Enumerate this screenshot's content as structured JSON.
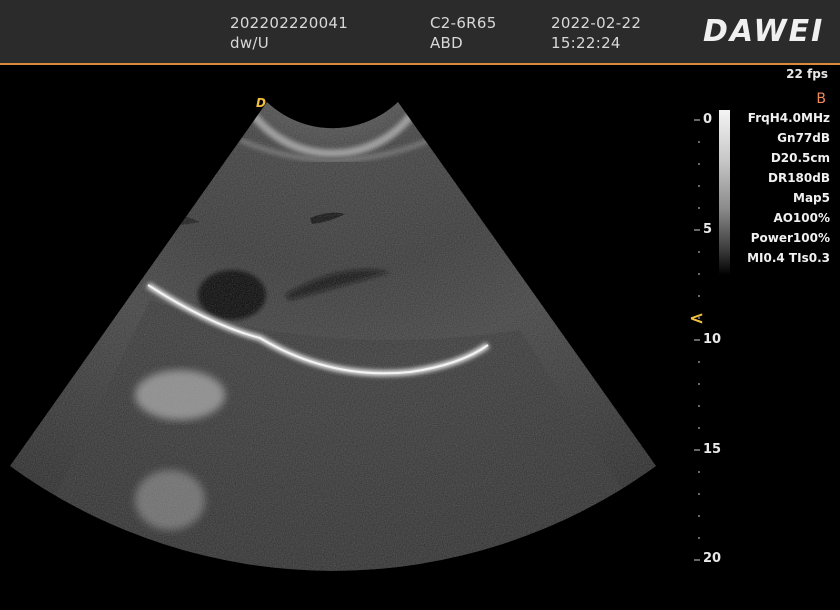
{
  "header": {
    "patient_id": "202202220041",
    "operator": "dw/U",
    "probe": "C2-6R65",
    "preset": "ABD",
    "date": "2022-02-22",
    "time": "15:22:24",
    "logo": "DAWEI"
  },
  "status": {
    "fps": "22 fps",
    "mode": "B",
    "focus_marker": "D"
  },
  "params": [
    "FrqH4.0MHz",
    "Gn77dB",
    "D20.5cm",
    "DR180dB",
    "Map5",
    "AO100%",
    "Power100%",
    "MI0.4 TIs0.3"
  ],
  "depth_scale": {
    "labels": [
      "0",
      "5",
      "10",
      "15",
      "20"
    ],
    "focus_glyph": "<"
  },
  "colors": {
    "header_bg": "#2b2b2b",
    "accent_line": "#d98a3a",
    "marker_yellow": "#f2c040",
    "mode_orange": "#f08a5a"
  }
}
